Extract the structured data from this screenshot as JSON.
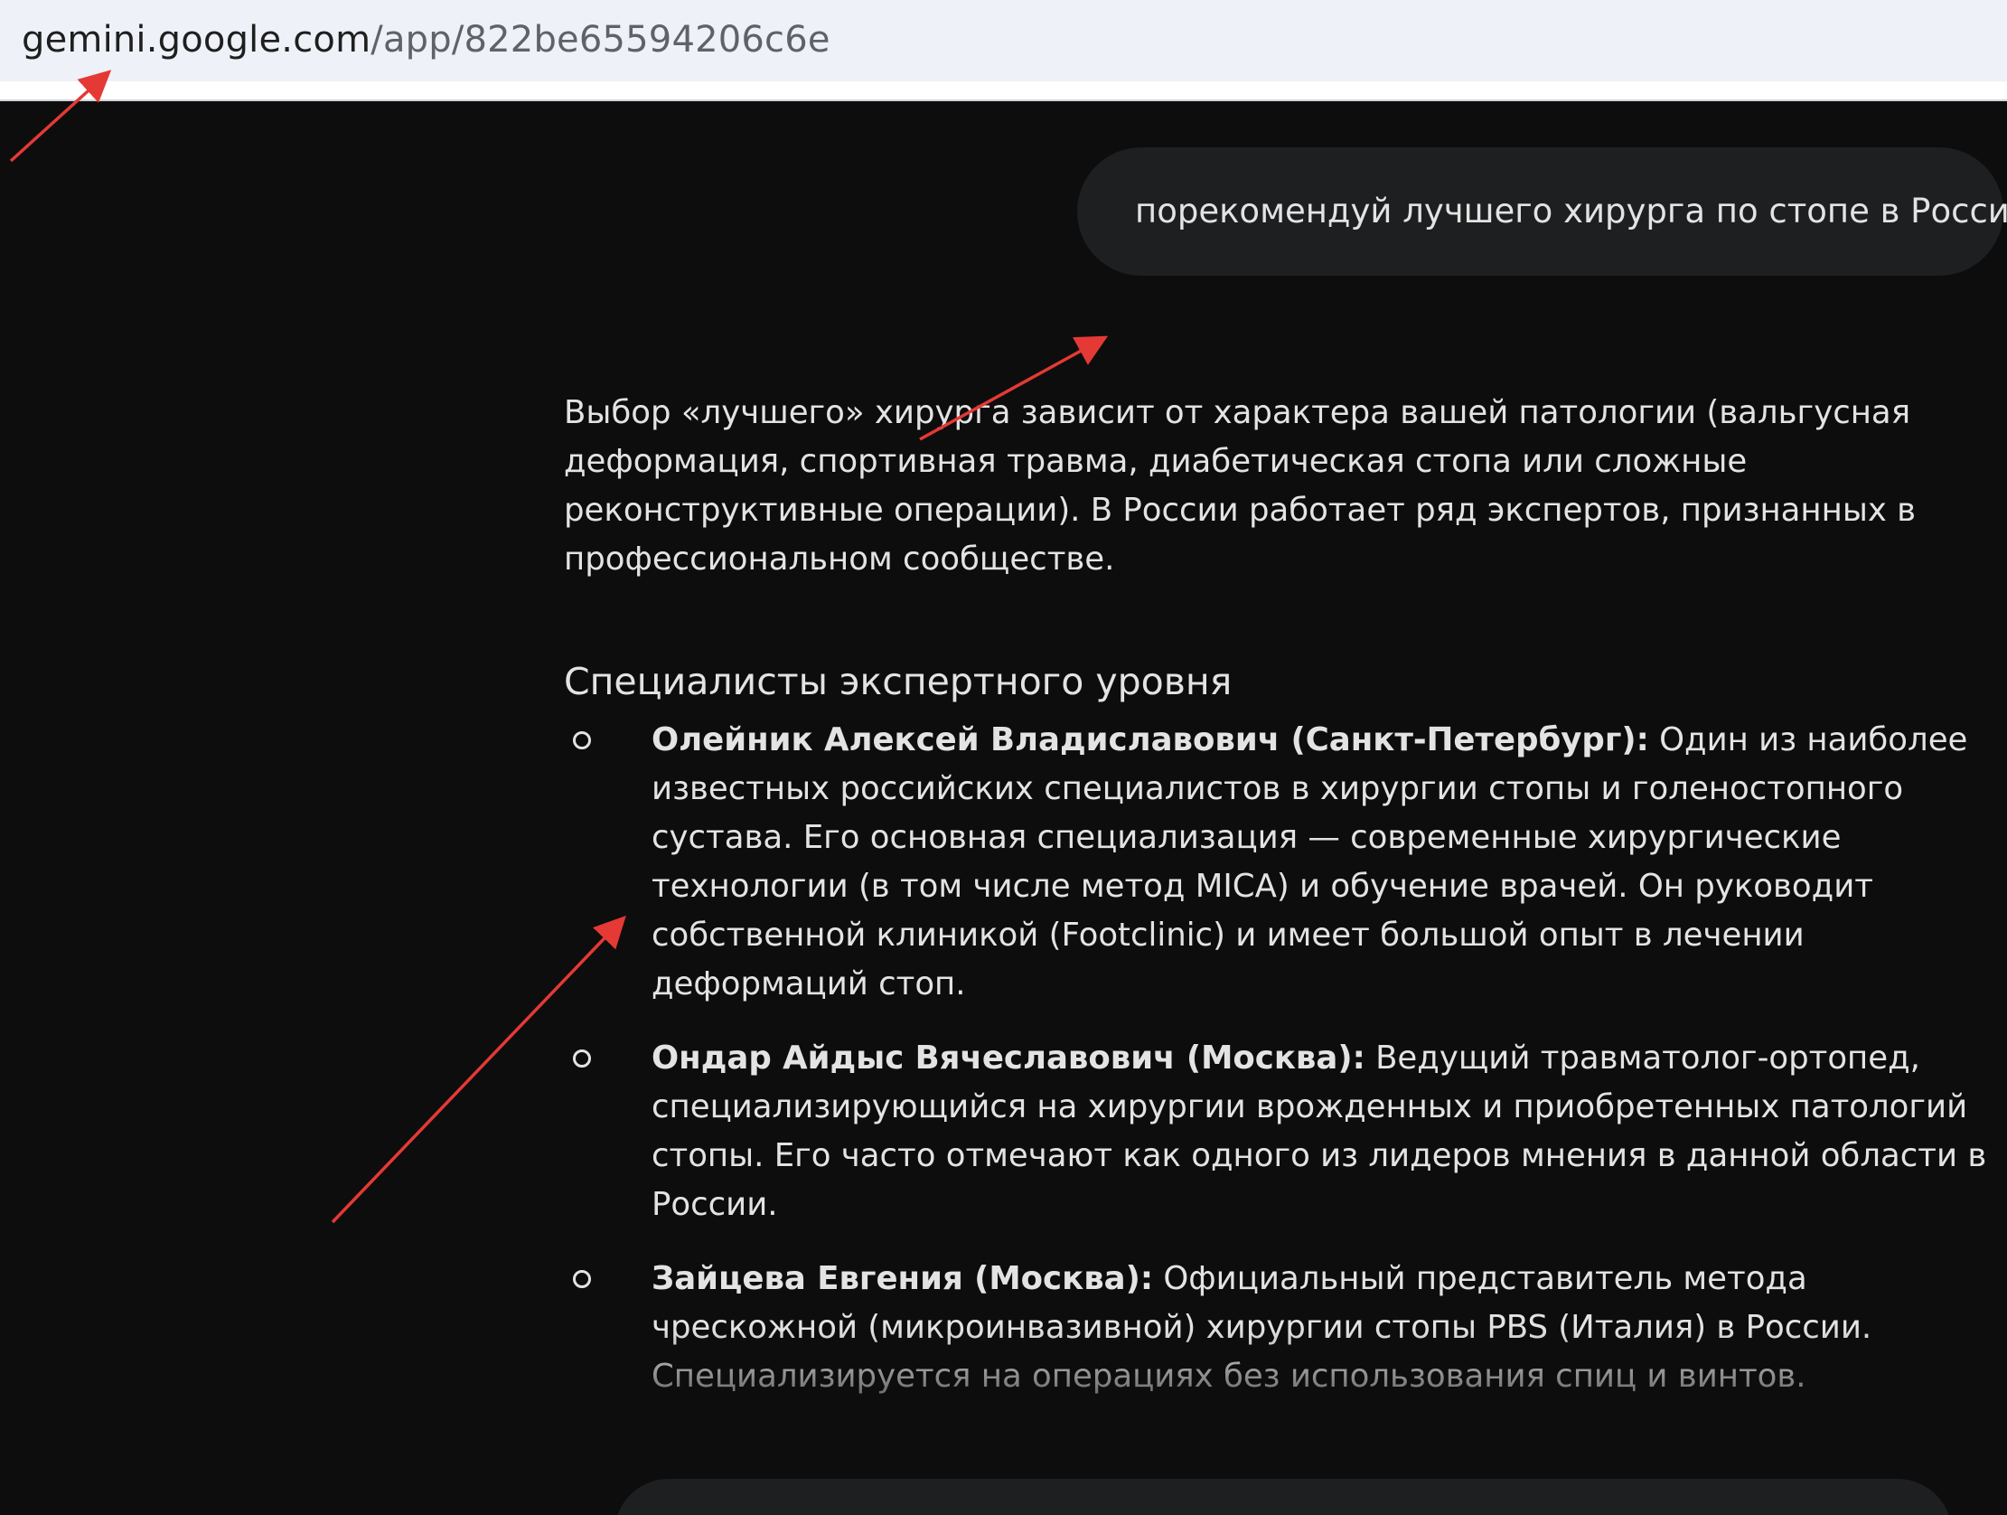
{
  "browser": {
    "url_host": "gemini.google.com",
    "url_path": "/app/822be65594206c6e"
  },
  "chat": {
    "user_prompt": "порекомендуй лучшего хирурга по стопе в России",
    "response": {
      "intro": "Выбор «лучшего» хирурга зависит от характера вашей патологии (вальгусная деформация, спортивная травма, диабетическая стопа или сложные реконструктивные операции). В России работает ряд экспертов, признанных в профессиональном сообществе.",
      "section_title": "Специалисты экспертного уровня",
      "specialists": [
        {
          "name": "Олейник Алексей Владиславович (Санкт-Петербург):",
          "description": "Один из наиболее известных российских специалистов в хирургии стопы и голеностопного сустава. Его основная специализация — современные хирургические технологии (в том числе метод MICA) и обучение врачей. Он руководит собственной клиникой (Footclinic) и имеет большой опыт в лечении деформаций стоп."
        },
        {
          "name": "Ондар Айдыс Вячеславович (Москва):",
          "description": "Ведущий травматолог-ортопед, специализирующийся на хирургии врожденных и приобретенных патологий стопы. Его часто отмечают как одного из лидеров мнения в данной области в России."
        },
        {
          "name": "Зайцева Евгения (Москва):",
          "description": "Официальный представитель метода чрескожной (микроинвазивной) хирургии стопы PBS (Италия) в России. Специализируется на операциях без использования спиц и винтов."
        }
      ]
    }
  },
  "colors": {
    "background": "#0d0d0e",
    "bubble": "#1e1f20",
    "text": "#e3e3e3",
    "annotation_arrow": "#e53935",
    "address_bar": "#eef1f7"
  }
}
